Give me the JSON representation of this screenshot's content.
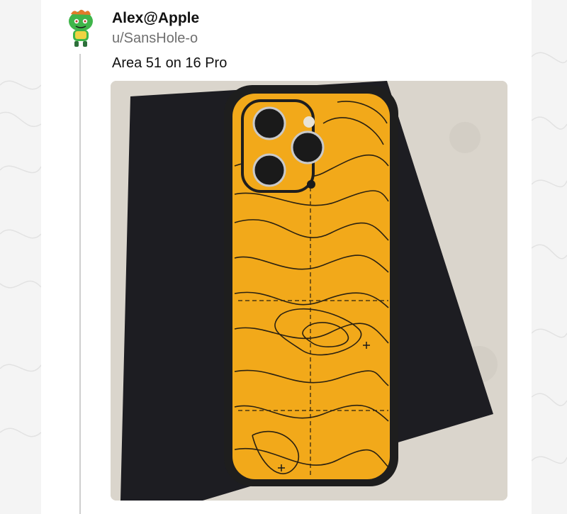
{
  "post": {
    "display_name": "Alex@Apple",
    "username": "u/SansHole-o",
    "text": "Area 51 on 16 Pro"
  },
  "icons": {
    "avatar": "snoo-avatar-icon"
  },
  "colors": {
    "card_background": "#ffffff",
    "page_background": "#f4f4f4",
    "case_yellow": "#f2a91a",
    "phone_black": "#1c1c1e"
  }
}
